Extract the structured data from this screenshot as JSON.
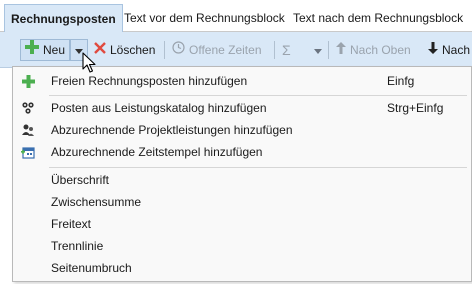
{
  "tabs": [
    {
      "label": "Rechnungsposten",
      "active": true
    },
    {
      "label": "Text vor dem Rechnungsblock",
      "active": false
    },
    {
      "label": "Text nach dem Rechnungsblock",
      "active": false
    }
  ],
  "toolbar": {
    "new_label": "Neu",
    "delete_label": "Löschen",
    "open_times_label": "Offene Zeiten",
    "sum_symbol": "Σ",
    "up_label": "Nach Oben",
    "down_label": "Nach"
  },
  "menu": {
    "items": [
      {
        "label": "Freien Rechnungsposten hinzufügen",
        "shortcut": "Einfg",
        "icon": "plus-icon"
      },
      {
        "label": "Posten aus Leistungskatalog hinzufügen",
        "shortcut": "Strg+Einfg",
        "icon": "catalog-icon"
      },
      {
        "label": "Abzurechnende Projektleistungen hinzufügen",
        "shortcut": "",
        "icon": "project-users-icon"
      },
      {
        "label": "Abzurechnende Zeitstempel hinzufügen",
        "shortcut": "",
        "icon": "calendar-add-icon"
      },
      {
        "label": "Überschrift",
        "shortcut": ""
      },
      {
        "label": "Zwischensumme",
        "shortcut": ""
      },
      {
        "label": "Freitext",
        "shortcut": ""
      },
      {
        "label": "Trennlinie",
        "shortcut": ""
      },
      {
        "label": "Seitenumbruch",
        "shortcut": ""
      }
    ]
  },
  "colors": {
    "toolbar_bg": "#d9e8f7",
    "active_tab_bg": "#d9e8f7",
    "plus_green": "#4caf50",
    "delete_red": "#e04a3f"
  }
}
